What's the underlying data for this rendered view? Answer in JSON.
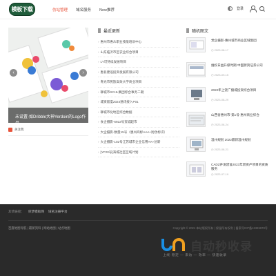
{
  "header": {
    "logo_text": "模板下载",
    "nav": [
      {
        "label": "仿站管理"
      },
      {
        "label": "域名服务"
      },
      {
        "label": "New推荐"
      }
    ],
    "user_label": "登录"
  },
  "slider": {
    "caption": "未设置-如Dribble大神Yerdoin的Logo作品",
    "prev": "‹",
    "next": "›"
  },
  "subscribe": {
    "label": "关注我"
  },
  "latest": {
    "title": "最近更新",
    "items": [
      "惠州市惠众职业技能培训中心",
      "山东临沂市区农业综合项目",
      "LY可持续发展项目",
      "惠县建设投资发展有限公司",
      "青光市民族高效大学商业项目",
      "聊城市SCHL集团综合事务二期",
      "城资嵌度2024通讯接入P01",
      "聊城市化地区综合数据",
      "食企摄影-6922号贸城超市",
      "大企摄影-数量15号（惠州商标AAA+防伪标识）",
      "大企摄影-102号江苏城市企业信用AA+创新",
      "[YF20号]海城社区区域计划"
    ]
  },
  "random": {
    "title": "随机图文",
    "items": [
      {
        "title": "党企摄影-惠州城市商业区域集团",
        "date": "2023-08-17"
      },
      {
        "title": "维权日益升级时期 中国新资证券公司",
        "date": "2023-09-15"
      },
      {
        "title": "2022年上饶广播城投资综合项目",
        "date": "2023-08-29"
      },
      {
        "title": "山西省惠州市-第1号-惠州商业综合",
        "date": "2023-08-24"
      },
      {
        "title": "温州规划 2022最新温州规划",
        "date": "2023-08-21"
      },
      {
        "title": "CADZ开发建设2023年新资产项目的资质服务",
        "date": "2023-07-19"
      }
    ]
  },
  "footer": {
    "links_label": "友情链接：",
    "links": [
      "织梦模板网",
      "域名注册平台"
    ],
    "nav": "百度地图导航 | 最新资料 | 网站地图 | 站点地图",
    "copyright": "Copyright © 2021 本站版权所有 | 保留所有权利 | 备案号ICP备12345678号",
    "watermark": "自动秒收录",
    "watermark_sub": "上线·稳定 — 来访 — 效率 — 快速收录"
  },
  "colors": {
    "accent": "#e8533a",
    "logo_bg": "#1f5c3a",
    "footer_bg": "#2a2a2a"
  }
}
